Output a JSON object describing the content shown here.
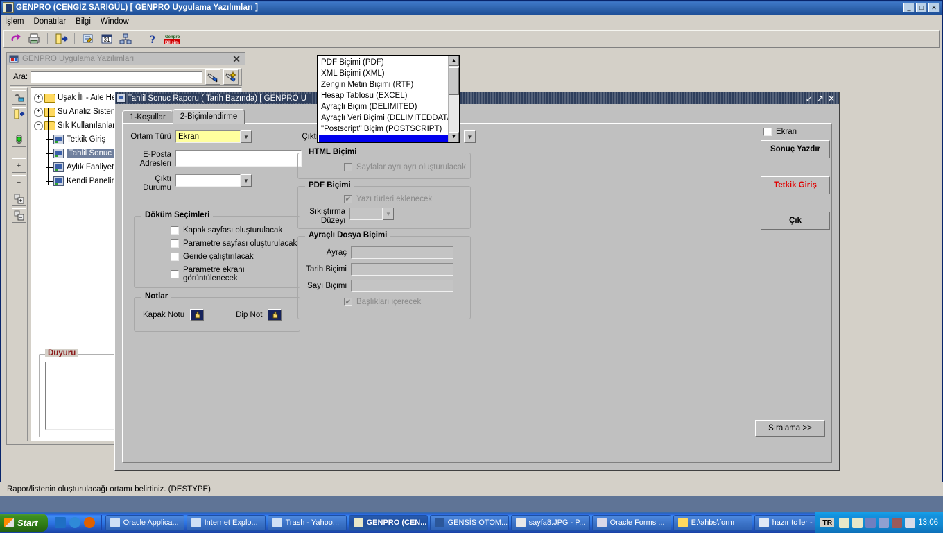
{
  "app": {
    "title": "GENPRO (CENGİZ SARIGÜL) [ GENPRO Uygulama Yazılımları ]",
    "icon": "java-coffee-icon",
    "window_buttons": {
      "minimize": "_",
      "maximize": "□",
      "close": "✕"
    },
    "menu": [
      "İşlem",
      "Donatılar",
      "Bilgi",
      "Window"
    ],
    "toolbar_icons": [
      "undo-icon",
      "print-icon",
      "exit-door-icon",
      "edit-form-icon",
      "calendar-icon",
      "network-icon",
      "help-icon",
      "genpro-bilisim-logo"
    ]
  },
  "mdi": {
    "title": "GENPRO Uygulama Yazılımları",
    "icon": "app-window-icon",
    "close_label": "✕",
    "search": {
      "label": "Ara:",
      "value": "",
      "placeholder": ""
    },
    "search_buttons": [
      "find-icon",
      "find-next-icon"
    ],
    "rail_buttons": [
      "connect-icon",
      "exit-door-icon",
      "traffic-light-icon",
      "expand-plus-icon",
      "collapse-minus-icon",
      "expand-all-icon",
      "collapse-all-icon"
    ],
    "rail_labels": [
      "",
      "",
      "",
      "+",
      "−",
      "+",
      "−"
    ],
    "tree": [
      {
        "label": "Uşak İli - Aile  Hek",
        "type": "folder",
        "expander": "+",
        "level": 0,
        "selected": false
      },
      {
        "label": "Su Analiz Sistemi",
        "type": "folder",
        "expander": "+",
        "level": 0,
        "selected": false
      },
      {
        "label": "Sık Kullanılanlar -",
        "type": "folder",
        "expander": "−",
        "level": 0,
        "selected": false
      },
      {
        "label": "Tetkik Giriş",
        "type": "doc",
        "expander": "",
        "level": 1,
        "selected": false
      },
      {
        "label": "Tahlil Sonuc R",
        "type": "doc",
        "expander": "",
        "level": 1,
        "selected": true
      },
      {
        "label": "Aylık Faaliyet",
        "type": "doc",
        "expander": "",
        "level": 1,
        "selected": false
      },
      {
        "label": "Kendi Panelini",
        "type": "doc",
        "expander": "",
        "level": 1,
        "selected": false
      }
    ],
    "duyuru": {
      "legend": "Duyuru",
      "content": ""
    }
  },
  "report": {
    "title": "Tahlil Sonuc Raporu ( Tarih Bazında) [ GENPRO U",
    "icon": "report-window-icon",
    "title_buttons": [
      "restore-down-icon",
      "maximize-icon",
      "close-icon"
    ],
    "tabs": [
      {
        "label": "1-Koşullar",
        "active": false
      },
      {
        "label": "2-Biçimlendirme",
        "active": true
      }
    ],
    "fields": {
      "ortam_turu": {
        "label": "Ortam Türü",
        "value": "Ekran"
      },
      "eposta": {
        "label": "E-Posta\nAdresleri",
        "label1": "E-Posta",
        "label2": "Adresleri",
        "value": ""
      },
      "cikti_durumu": {
        "label1": "Çıktı",
        "label2": "Durumu",
        "value": ""
      },
      "cikti": {
        "label": "Çıktı",
        "value": ""
      }
    },
    "dokum": {
      "legend": "Döküm Seçimleri",
      "items": [
        {
          "label": "Kapak sayfası oluşturulacak",
          "checked": false,
          "disabled": false
        },
        {
          "label": "Parametre sayfası oluşturulacak",
          "checked": false,
          "disabled": false
        },
        {
          "label": "Geride çalıştırılacak",
          "checked": false,
          "disabled": false
        },
        {
          "label": "Parametre ekranı görüntülenecek",
          "checked": false,
          "disabled": false
        }
      ]
    },
    "notlar": {
      "legend": "Notlar",
      "kapak_notu_label": "Kapak Notu",
      "dip_not_label": "Dip Not",
      "button_icon": "hand-pointer-icon"
    },
    "html_bicimi": {
      "legend": "HTML Biçimi",
      "checkbox": {
        "label": "Sayfalar ayrı ayrı oluşturulacak",
        "checked": false,
        "disabled": true
      }
    },
    "pdf_bicimi": {
      "legend": "PDF Biçimi",
      "checkbox": {
        "label": "Yazı türleri eklenecek",
        "checked": true,
        "disabled": true
      },
      "sikistirma": {
        "label1": "Sıkıştırma",
        "label2": "Düzeyi",
        "value": ""
      }
    },
    "ayracli": {
      "legend": "Ayraçlı Dosya Biçimi",
      "rows": [
        {
          "label": "Ayraç",
          "value": ""
        },
        {
          "label": "Tarih Biçimi",
          "value": ""
        },
        {
          "label": "Sayı Biçimi",
          "value": ""
        }
      ],
      "checkbox": {
        "label": "Başlıkları içerecek",
        "checked": true,
        "disabled": true
      }
    },
    "right_column": {
      "ekran_checkbox": {
        "label": "Ekran",
        "checked": false
      },
      "buttons": [
        {
          "label": "Sonuç Yazdır",
          "style": "normal"
        },
        {
          "label": "Tetkik Giriş",
          "style": "red"
        },
        {
          "label": "Çık",
          "style": "normal"
        }
      ],
      "sort_button": {
        "label": "Sıralama >>"
      }
    }
  },
  "dropdown": {
    "items": [
      {
        "label": "PDF Biçimi (PDF)",
        "selected": false
      },
      {
        "label": "XML Biçimi (XML)",
        "selected": false
      },
      {
        "label": "Zengin Metin Biçimi (RTF)",
        "selected": false
      },
      {
        "label": "Hesap Tablosu (EXCEL)",
        "selected": false
      },
      {
        "label": "Ayraçlı Biçim (DELIMITED)",
        "selected": false
      },
      {
        "label": "Ayraçlı Veri Biçimi (DELIMITEDDATA)",
        "selected": false
      },
      {
        "label": "\"Postscript\" Biçim (POSTSCRIPT)",
        "selected": false
      },
      {
        "label": "",
        "selected": true
      }
    ],
    "scroll_up": "▲",
    "scroll_down": "▼"
  },
  "statusbar": {
    "text": "Rapor/listenin oluşturulacağı ortamı belirtiniz. (DESTYPE)"
  },
  "taskbar": {
    "start_label": "Start",
    "quick_launch": [
      "outlook-icon",
      "internet-explorer-icon",
      "firefox-icon"
    ],
    "tasks": [
      {
        "label": "Oracle Applica...",
        "icon": "ie-doc-icon",
        "active": false
      },
      {
        "label": "Internet Explo...",
        "icon": "ie-doc-icon",
        "active": false
      },
      {
        "label": "Trash - Yahoo...",
        "icon": "ie-doc-icon",
        "active": false
      },
      {
        "label": "GENPRO (CEN...",
        "icon": "java-coffee-icon",
        "active": true
      },
      {
        "label": "GENSİS OTOM...",
        "icon": "word-doc-icon",
        "active": false
      },
      {
        "label": "sayfa8.JPG - P...",
        "icon": "paint-icon",
        "active": false
      },
      {
        "label": "Oracle Forms ...",
        "icon": "oracle-forms-icon",
        "active": false
      },
      {
        "label": "E:\\ahbs\\form",
        "icon": "folder-icon",
        "active": false
      },
      {
        "label": "hazır tc ler - N...",
        "icon": "notepad-icon",
        "active": false
      }
    ],
    "tray": {
      "language": "TR",
      "icons": [
        "java-icon",
        "java-icon",
        "network-icon",
        "usb-icon",
        "volume-muted-icon",
        "volume-icon"
      ],
      "clock": "13:06"
    }
  },
  "colors": {
    "desktop": "#5f7496",
    "window_face": "#d4d0c8",
    "dialog_face": "#c0c0c0",
    "title_active": "#2e63ad",
    "dialog_title": "#2e3e5c",
    "selection_blue": "#0000ee",
    "highlight_yellow": "#ffff9e",
    "red_accent": "#e00000",
    "duyuru_red": "#8b1a1a"
  }
}
